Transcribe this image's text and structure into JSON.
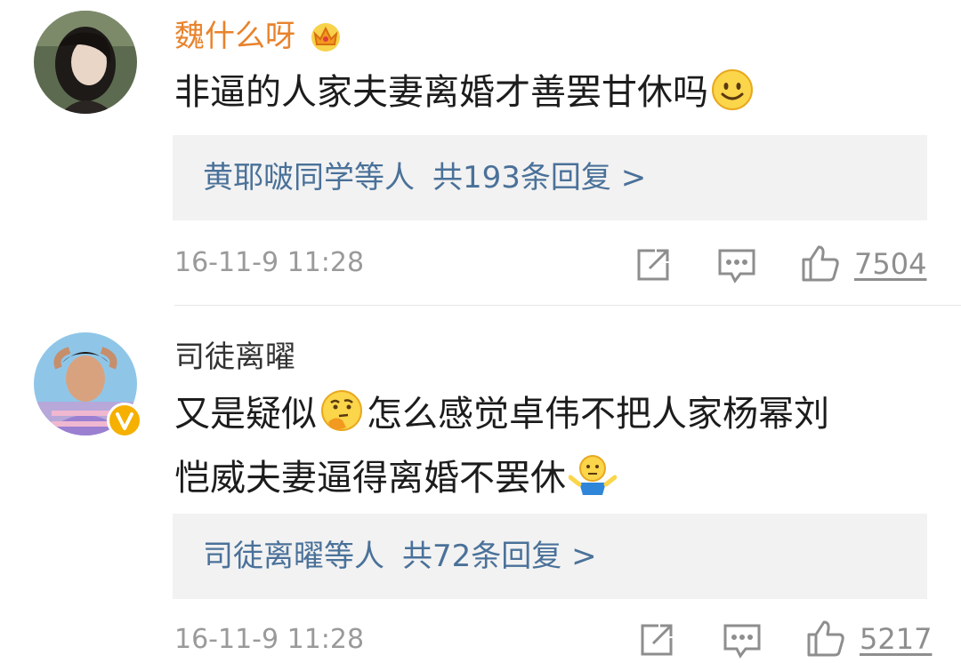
{
  "comments": [
    {
      "username": "魏什么呀",
      "username_color": "#e8832c",
      "text": "非逼的人家夫妻离婚才善罢甘休吗",
      "reply": {
        "names": "黄耶啵同学等人",
        "count_text": "共193条回复 >"
      },
      "time": "16-11-9 11:28",
      "likes": "7504"
    },
    {
      "username": "司徒离曜",
      "username_color": "#333333",
      "text_line1_a": "又是疑似",
      "text_line1_b": "怎么感觉卓伟不把人家杨幂刘",
      "text_line2": "恺威夫妻逼得离婚不罢休",
      "reply": {
        "names": "司徒离曜等人",
        "count_text": "共72条回复 >"
      },
      "time": "16-11-9 11:28",
      "likes": "5217"
    }
  ],
  "icons": {
    "crown": "crown-icon",
    "smile": "smile-emoji",
    "think": "thinking-emoji",
    "shrug": "shrug-emoji",
    "share": "share-icon",
    "comment": "comment-icon",
    "like": "thumbs-up-icon",
    "verified": "verified-badge"
  }
}
